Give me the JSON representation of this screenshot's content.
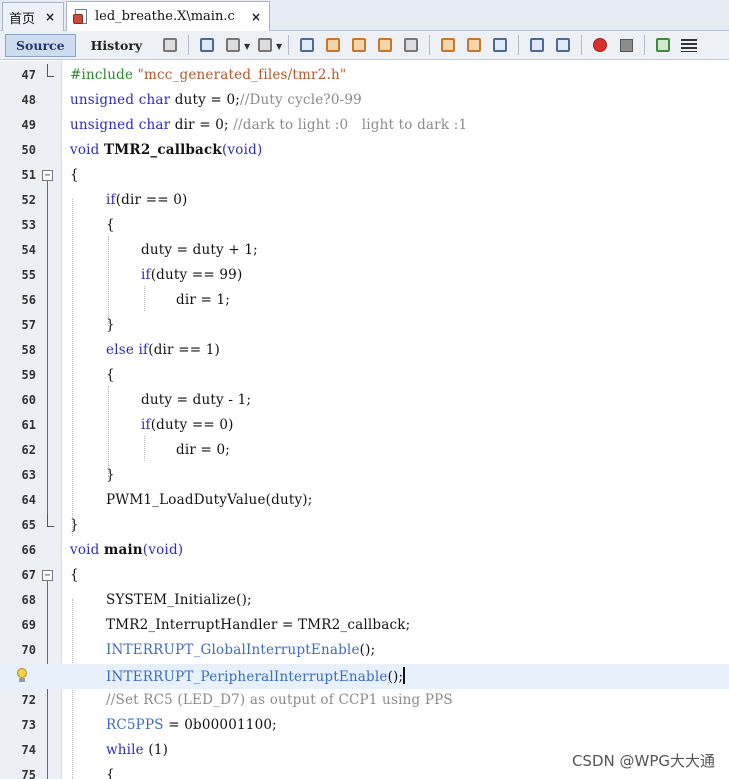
{
  "tabs": [
    {
      "label": "首页",
      "close": "×"
    },
    {
      "label": "led_breathe.X\\main.c",
      "close": "×"
    }
  ],
  "toolbar": {
    "source_label": "Source",
    "history_label": "History",
    "icons": [
      "file-icon",
      "back-icon",
      "forward-icon",
      "nav-icon",
      "search-icon",
      "find-prev-icon",
      "find-next-icon",
      "toggle-highlight-icon",
      "select-icon",
      "prev-bookmark-icon",
      "next-bookmark-icon",
      "toggle-bookmark-icon",
      "shift-left-icon",
      "shift-right-icon",
      "record-macro-icon",
      "stop-macro-icon",
      "comment-icon",
      "uncomment-icon"
    ]
  },
  "code": [
    {
      "n": "47",
      "fold": "end"
    },
    {
      "n": "48"
    },
    {
      "n": "49"
    },
    {
      "n": "50"
    },
    {
      "n": "51",
      "fold": "open"
    },
    {
      "n": "52"
    },
    {
      "n": "53"
    },
    {
      "n": "54"
    },
    {
      "n": "55"
    },
    {
      "n": "56"
    },
    {
      "n": "57"
    },
    {
      "n": "58"
    },
    {
      "n": "59"
    },
    {
      "n": "60"
    },
    {
      "n": "61"
    },
    {
      "n": "62"
    },
    {
      "n": "63"
    },
    {
      "n": "64"
    },
    {
      "n": "65",
      "fold": "end"
    },
    {
      "n": "66"
    },
    {
      "n": "67",
      "fold": "open"
    },
    {
      "n": "68"
    },
    {
      "n": "69"
    },
    {
      "n": "70"
    },
    {
      "n": "",
      "hint": "bulb"
    },
    {
      "n": "72"
    },
    {
      "n": "73"
    },
    {
      "n": "74"
    },
    {
      "n": "75"
    }
  ],
  "lines": {
    "l47": {
      "pp": "#include ",
      "str": "\"mcc_generated_files/tmr2.h\""
    },
    "l48": {
      "kw": "unsigned char",
      "rest": " duty = 0;",
      "cm": "//Duty cycle?0-99"
    },
    "l49": {
      "kw": "unsigned char",
      "rest": " dir = 0; ",
      "cm": "//dark to light :0   light to dark :1"
    },
    "l50": {
      "kw": "void ",
      "fn": "TMR2_callback",
      "rest": "(",
      "kw2": "void",
      "rest2": ")"
    },
    "l51": {
      "rest": "{"
    },
    "l52": {
      "kw": "if",
      "rest": "(dir == 0)"
    },
    "l53": {
      "rest": "{"
    },
    "l54": {
      "rest": "duty = duty + 1;"
    },
    "l55": {
      "kw": "if",
      "rest": "(duty == 99)"
    },
    "l56": {
      "rest": "dir = 1;"
    },
    "l57": {
      "rest": "}"
    },
    "l58": {
      "kw": "else if",
      "rest": "(dir == 1)"
    },
    "l59": {
      "rest": "{"
    },
    "l60": {
      "rest": "duty = duty - 1;"
    },
    "l61": {
      "kw": "if",
      "rest": "(duty == 0)"
    },
    "l62": {
      "rest": "dir = 0;"
    },
    "l63": {
      "rest": "}"
    },
    "l64": {
      "rest": "PWM1_LoadDutyValue(duty);"
    },
    "l65": {
      "rest": "}"
    },
    "l66": {
      "kw": "void ",
      "fn": "main",
      "rest": "(",
      "kw2": "void",
      "rest2": ")"
    },
    "l67": {
      "rest": "{"
    },
    "l68": {
      "rest": "SYSTEM_Initialize();"
    },
    "l69": {
      "rest": "TMR2_InterruptHandler = TMR2_callback;"
    },
    "l70": {
      "mac": "INTERRUPT_GlobalInterruptEnable",
      "rest": "();"
    },
    "l71": {
      "mac": "INTERRUPT_PeripheralInterruptEnable",
      "rest": "();"
    },
    "l72": {
      "cm": "//Set RC5 (LED_D7) as output of CCP1 using PPS"
    },
    "l73": {
      "mac": "RC5PPS",
      "rest": " = 0b00001100;"
    },
    "l74": {
      "kw": "while",
      "rest": " (1)"
    },
    "l75": {
      "rest": "{"
    }
  },
  "watermark": "CSDN @WPG大大通"
}
